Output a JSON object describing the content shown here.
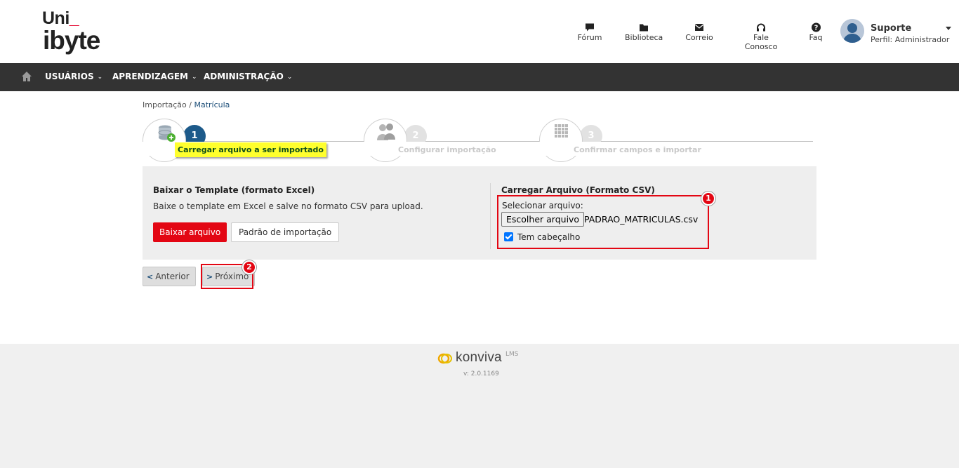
{
  "brand": {
    "line1": "Uni",
    "underscore": "_",
    "line2": "ibyte"
  },
  "topnav": [
    {
      "label": "Fórum",
      "icon": "chat-icon"
    },
    {
      "label": "Biblioteca",
      "icon": "folder-icon"
    },
    {
      "label": "Correio",
      "icon": "envelope-icon"
    },
    {
      "label": "Fale Conosco",
      "icon": "headset-icon"
    },
    {
      "label": "Faq",
      "icon": "question-icon"
    }
  ],
  "user": {
    "name": "Suporte",
    "profile": "Perfil: Administrador"
  },
  "menu": [
    {
      "label": "USUÁRIOS"
    },
    {
      "label": "APRENDIZAGEM"
    },
    {
      "label": "ADMINISTRAÇÃO"
    }
  ],
  "breadcrumb": {
    "parent": "Importação",
    "separator": " / ",
    "current": "Matrícula"
  },
  "wizard": {
    "steps": [
      {
        "num": "1",
        "label": "Carregar arquivo a ser importado",
        "active": true
      },
      {
        "num": "2",
        "label": "Configurar importação",
        "active": false
      },
      {
        "num": "3",
        "label": "Confirmar campos e importar",
        "active": false
      }
    ]
  },
  "template_section": {
    "title": "Baixar o Template (formato Excel)",
    "description": "Baixe o template em Excel e salve no formato CSV para upload.",
    "download_button": "Baixar arquivo",
    "pattern_button": "Padrão de importação"
  },
  "upload_section": {
    "title": "Carregar Arquivo (Formato CSV)",
    "select_label": "Selecionar arquivo:",
    "choose_button": "Escolher arquivo",
    "file_name": "PADRAO_MATRICULAS.csv",
    "has_header_label": "Tem cabeçalho",
    "has_header_checked": true
  },
  "annotations": [
    "1",
    "2"
  ],
  "navigation": {
    "previous": "Anterior",
    "next": "Próximo"
  },
  "footer": {
    "product": "konviva",
    "product_sup": "LMS",
    "version": "v: 2.0.1169"
  },
  "colors": {
    "accent_red": "#e30613",
    "menubar": "#333333",
    "step_active": "#1d5a8a",
    "highlight_yellow": "#ffff2e"
  }
}
